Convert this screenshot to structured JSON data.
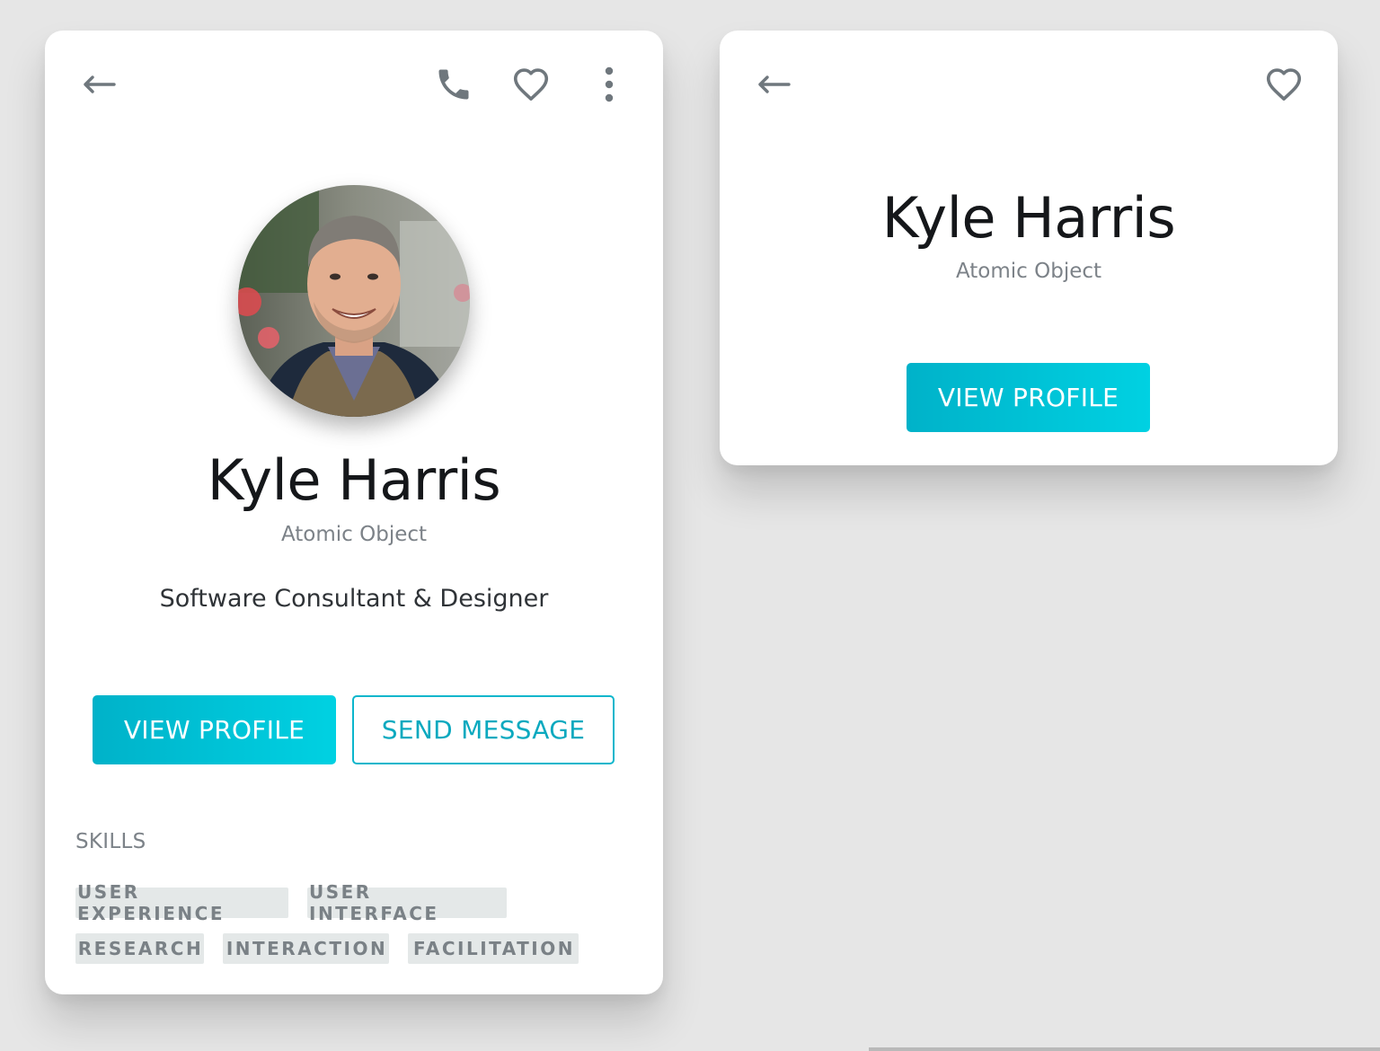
{
  "expanded_card": {
    "name": "Kyle Harris",
    "company": "Atomic Object",
    "title": "Software Consultant & Designer",
    "view_profile_label": "VIEW PROFILE",
    "send_message_label": "SEND MESSAGE",
    "skills_heading": "SKILLS",
    "skills": [
      "USER EXPERIENCE",
      "USER INTERFACE",
      "RESEARCH",
      "INTERACTION",
      "FACILITATION"
    ],
    "icons": [
      "back-arrow-icon",
      "phone-icon",
      "heart-icon",
      "more-vertical-icon"
    ]
  },
  "compact_card": {
    "name": "Kyle Harris",
    "company": "Atomic Object",
    "view_profile_label": "VIEW PROFILE",
    "icons": [
      "back-arrow-icon",
      "heart-icon"
    ]
  },
  "colors": {
    "accent": "#00c2d6",
    "accent_gradient_start": "#00b2c9",
    "accent_gradient_end": "#00d1e2",
    "icon": "#6f777d",
    "chip_bg": "#e4e8e8",
    "background": "#e6e6e6"
  }
}
